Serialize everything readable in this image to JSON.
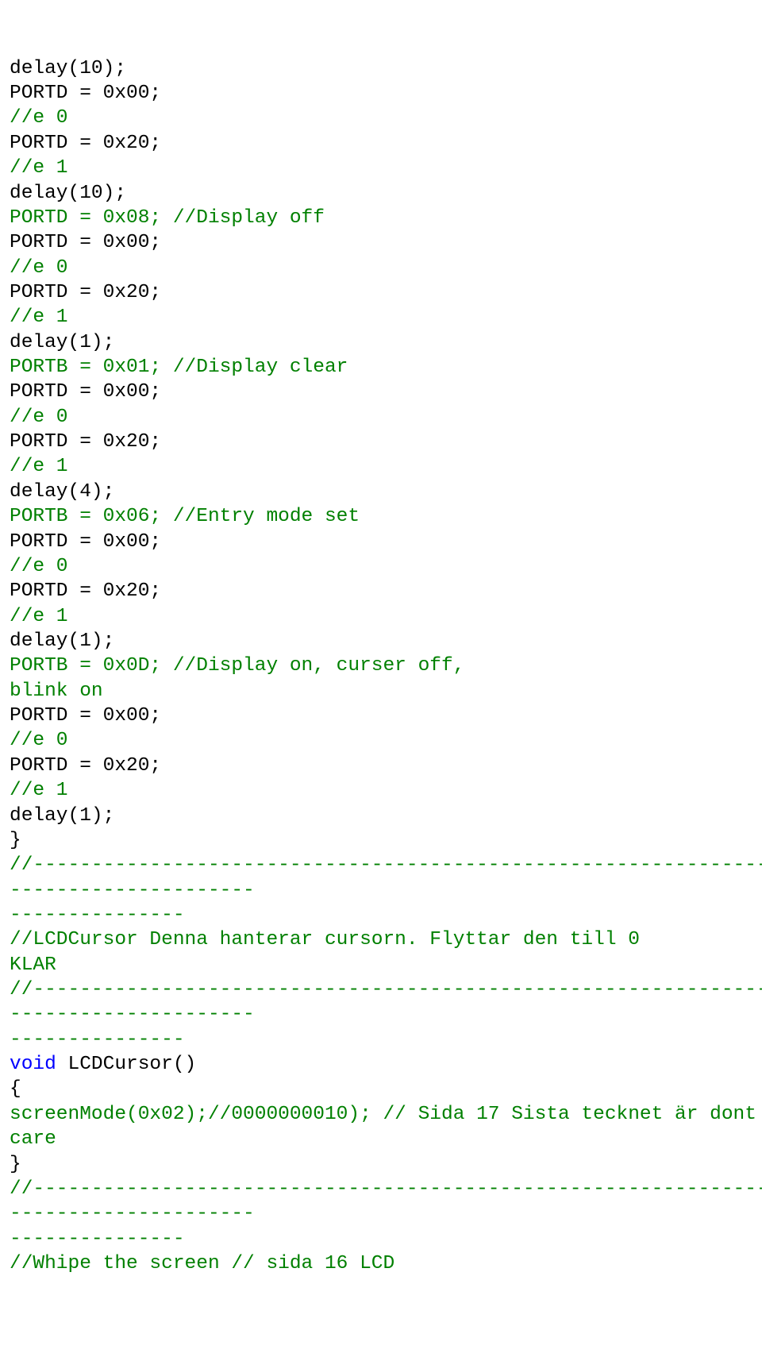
{
  "lines": [
    {
      "cls": "",
      "text": "delay(10);"
    },
    {
      "cls": "",
      "text": "PORTD = 0x00;"
    },
    {
      "cls": "green",
      "text": "//e 0"
    },
    {
      "cls": "",
      "text": "PORTD = 0x20;"
    },
    {
      "cls": "green",
      "text": "//e 1"
    },
    {
      "cls": "",
      "text": "delay(10);"
    },
    {
      "cls": "green",
      "text": "PORTD = 0x08; //Display off"
    },
    {
      "cls": "",
      "text": "PORTD = 0x00;"
    },
    {
      "cls": "green",
      "text": "//e 0"
    },
    {
      "cls": "",
      "text": "PORTD = 0x20;"
    },
    {
      "cls": "green",
      "text": "//e 1"
    },
    {
      "cls": "",
      "text": "delay(1);"
    },
    {
      "cls": "green",
      "text": "PORTB = 0x01; //Display clear"
    },
    {
      "cls": "",
      "text": "PORTD = 0x00;"
    },
    {
      "cls": "green",
      "text": "//e 0"
    },
    {
      "cls": "",
      "text": "PORTD = 0x20;"
    },
    {
      "cls": "green",
      "text": "//e 1"
    },
    {
      "cls": "",
      "text": "delay(4);"
    },
    {
      "cls": "green",
      "text": "PORTB = 0x06; //Entry mode set"
    },
    {
      "cls": "",
      "text": "PORTD = 0x00;"
    },
    {
      "cls": "green",
      "text": "//e 0"
    },
    {
      "cls": "",
      "text": "PORTD = 0x20;"
    },
    {
      "cls": "green",
      "text": "//e 1"
    },
    {
      "cls": "",
      "text": "delay(1);"
    },
    {
      "cls": "green",
      "text": "PORTB = 0x0D; //Display on, curser off,"
    },
    {
      "cls": "green",
      "text": "blink on"
    },
    {
      "cls": "",
      "text": "PORTD = 0x00;"
    },
    {
      "cls": "green",
      "text": "//e 0"
    },
    {
      "cls": "",
      "text": "PORTD = 0x20;"
    },
    {
      "cls": "green",
      "text": "//e 1"
    },
    {
      "cls": "",
      "text": "delay(1);"
    },
    {
      "cls": "",
      "text": "}"
    },
    {
      "cls": "green",
      "text": "//-----------------------------------------------------------------"
    },
    {
      "cls": "green",
      "text": "---------------------"
    },
    {
      "cls": "green",
      "text": "---------------"
    },
    {
      "cls": "green",
      "text": "//LCDCursor Denna hanterar cursorn. Flyttar den till 0"
    },
    {
      "cls": "green",
      "text": "KLAR"
    },
    {
      "cls": "green",
      "text": "//-----------------------------------------------------------------"
    },
    {
      "cls": "green",
      "text": "---------------------"
    },
    {
      "cls": "green",
      "text": "---------------"
    },
    {
      "cls": "",
      "spans": [
        {
          "cls": "blue",
          "text": "void"
        },
        {
          "cls": "",
          "text": " LCDCursor()"
        }
      ]
    },
    {
      "cls": "",
      "text": "{"
    },
    {
      "cls": "green",
      "text": "screenMode(0x02);//0000000010); // Sida 17 Sista tecknet är dont"
    },
    {
      "cls": "green",
      "text": "care"
    },
    {
      "cls": "",
      "text": "}"
    },
    {
      "cls": "green",
      "text": "//-----------------------------------------------------------------"
    },
    {
      "cls": "green",
      "text": "---------------------"
    },
    {
      "cls": "green",
      "text": "---------------"
    },
    {
      "cls": "green",
      "text": "//Whipe the screen // sida 16 LCD"
    }
  ]
}
